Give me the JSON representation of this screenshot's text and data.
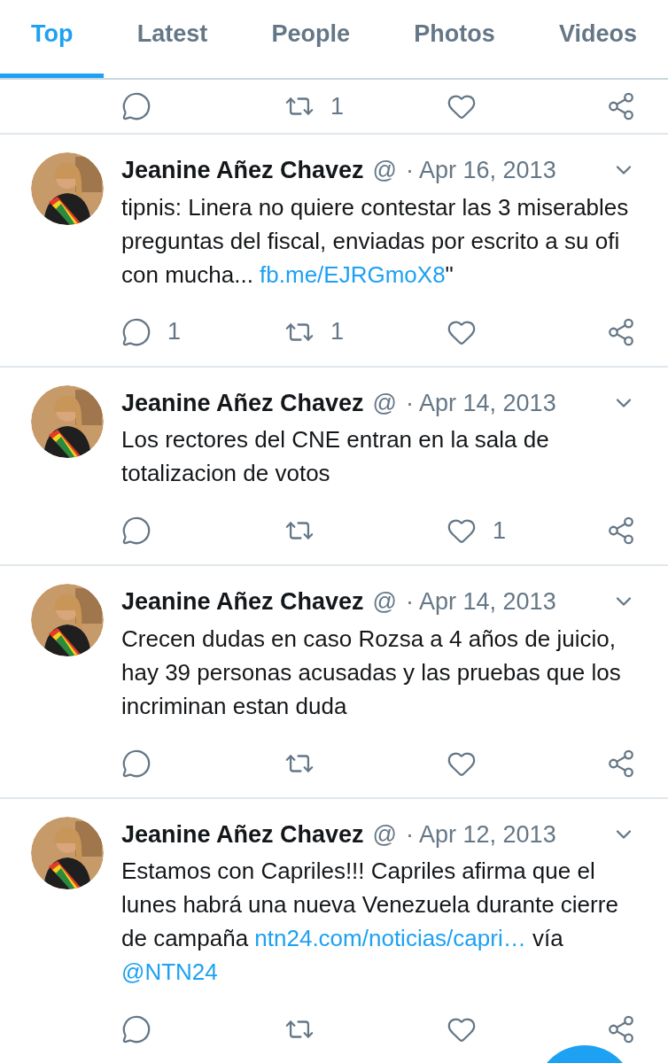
{
  "tabs": [
    {
      "label": "Top",
      "selected": true
    },
    {
      "label": "Latest",
      "selected": false
    },
    {
      "label": "People",
      "selected": false
    },
    {
      "label": "Photos",
      "selected": false
    },
    {
      "label": "Videos",
      "selected": false
    }
  ],
  "top_actions": {
    "retweet": "1"
  },
  "tweets": [
    {
      "name": "Jeanine Añez Chavez",
      "handle": "@",
      "date": "· Apr 16, 2013",
      "body": [
        {
          "kind": "text",
          "text": "tipnis: Linera no quiere contestar las 3 miserables preguntas del fiscal, enviadas por escrito a su ofi con mucha... "
        },
        {
          "kind": "link",
          "text": "fb.me/EJRGmoX8"
        },
        {
          "kind": "text",
          "text": "\""
        }
      ],
      "actions": {
        "reply": "1",
        "retweet": "1"
      }
    },
    {
      "name": "Jeanine Añez Chavez",
      "handle": "@",
      "date": "· Apr 14, 2013",
      "body": [
        {
          "kind": "text",
          "text": "Los rectores del CNE entran en la sala de totalizacion de votos"
        }
      ],
      "actions": {
        "like": "1"
      }
    },
    {
      "name": "Jeanine Añez Chavez",
      "handle": "@",
      "date": "· Apr 14, 2013",
      "body": [
        {
          "kind": "text",
          "text": "Crecen dudas en caso Rozsa a 4 años de juicio, hay 39 personas acusadas y las pruebas que los incriminan estan duda"
        }
      ]
    },
    {
      "name": "Jeanine Añez Chavez",
      "handle": "@",
      "date": "· Apr 12, 2013",
      "body": [
        {
          "kind": "text",
          "text": "Estamos con Capriles!!! Capriles afirma que el lunes habrá una nueva Venezuela durante cierre de campaña "
        },
        {
          "kind": "link",
          "text": "ntn24.com/noticias/capri…"
        },
        {
          "kind": "text",
          "text": " vía "
        },
        {
          "kind": "link",
          "text": "@NTN24"
        }
      ]
    }
  ]
}
